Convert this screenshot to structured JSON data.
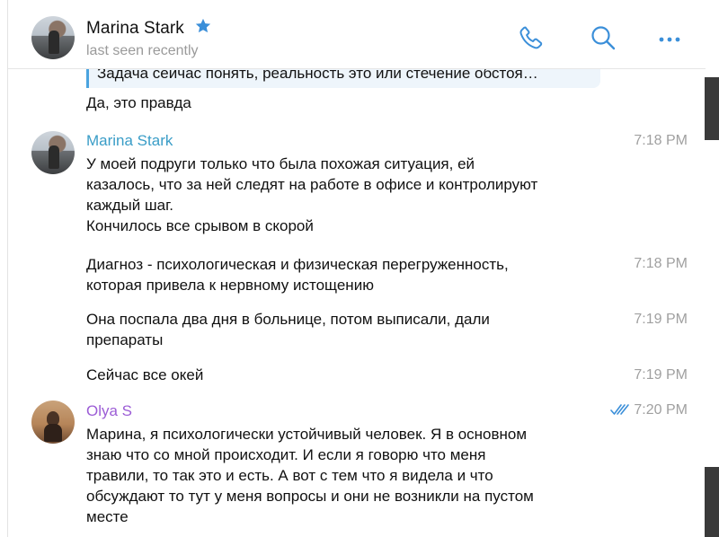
{
  "header": {
    "name": "Marina Stark",
    "status": "last seen recently",
    "star_color": "#3b8fd9",
    "icons": [
      "phone-icon",
      "search-icon",
      "more-icon"
    ],
    "accent_color": "#3b8fd9"
  },
  "quote": {
    "text": "Задача сейчас понять, реальность это или стечение обстоя…"
  },
  "messages": [
    {
      "text": "Да, это правда"
    },
    {
      "sender": "Marina Stark",
      "time": "7:18 PM",
      "lines": [
        "У моей подруги только что была похожая ситуация, ей",
        "казалось, что за ней следят на работе в офисе и контролируют",
        "каждый шаг.",
        "Кончилось все срывом в скорой"
      ]
    },
    {
      "time": "7:18 PM",
      "lines": [
        "Диагноз - психологическая и физическая перегруженность,",
        "которая привела к нервному истощению"
      ]
    },
    {
      "time": "7:19 PM",
      "lines": [
        "Она поспала два дня в больнице, потом выписали, дали",
        "препараты"
      ]
    },
    {
      "time": "7:19 PM",
      "lines": [
        "Сейчас все окей"
      ]
    },
    {
      "sender": "Olya S",
      "time": "7:20 PM",
      "read": true,
      "lines": [
        "Марина, я психологически устойчивый человек. Я в основном",
        "знаю что со мной происходит. И если я говорю что меня",
        "травили, то так это и есть. А вот с тем что я видела и что",
        "обсуждают то тут у меня вопросы и они не возникли на пустом",
        "месте"
      ]
    }
  ],
  "colors": {
    "marina_name": "#3a9dc7",
    "olya_name": "#9c5dd6",
    "time": "#a0a0a0",
    "quote_bg": "#eef5fb",
    "quote_border": "#4aa3df"
  }
}
